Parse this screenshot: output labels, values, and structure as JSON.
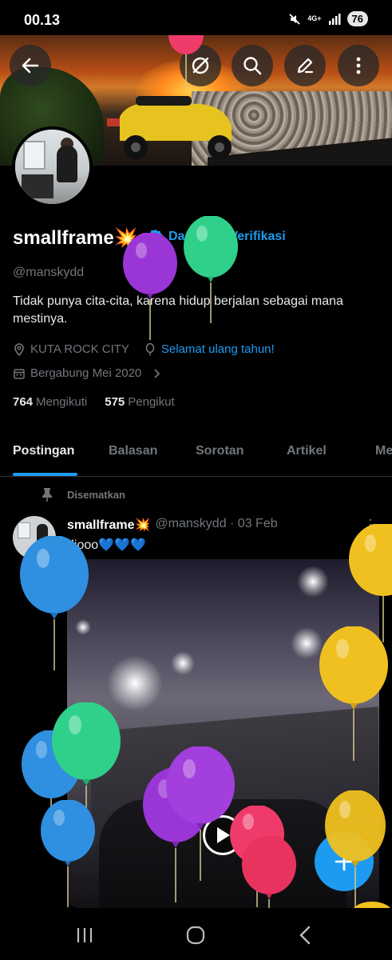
{
  "status_bar": {
    "time": "00.13",
    "network": "4G+",
    "battery": "76",
    "icons": [
      "mute-icon",
      "network-icon",
      "signal-icon",
      "battery-icon"
    ]
  },
  "header": {
    "buttons": [
      "back-arrow-icon",
      "grok-icon",
      "search-icon",
      "edit-icon",
      "more-vertical-icon"
    ]
  },
  "profile": {
    "name": "smallframe💥",
    "verify_label": "Dapatkan Verifikasi",
    "handle": "@manskydd",
    "bio": "Tidak punya cita-cita, karena hidup berjalan sebagai mana mestinya.",
    "location": "KUTA ROCK CITY",
    "birthday": "Selamat ulang tahun!",
    "joined": "Bergabung Mei 2020",
    "following_count": "764",
    "following_label": "Mengikuti",
    "followers_count": "575",
    "followers_label": "Pengikut"
  },
  "tabs": [
    {
      "label": "Postingan",
      "active": true
    },
    {
      "label": "Balasan",
      "active": false
    },
    {
      "label": "Sorotan",
      "active": false
    },
    {
      "label": "Artikel",
      "active": false
    },
    {
      "label": "Me",
      "active": false
    }
  ],
  "pinned_label": "Disematkan",
  "tweet": {
    "name": "smallframe💥",
    "handle_date": "@manskydd · 03 Feb",
    "text": "diooo💙💙💙"
  },
  "colors": {
    "accent": "#1d9bf0",
    "background": "#000000",
    "muted": "#71767b",
    "balloon_blue": "#2f8fe0",
    "balloon_green": "#2fd18a",
    "balloon_purple": "#9a35d6",
    "balloon_yellow": "#f0c020",
    "balloon_red": "#ef3b6a"
  }
}
